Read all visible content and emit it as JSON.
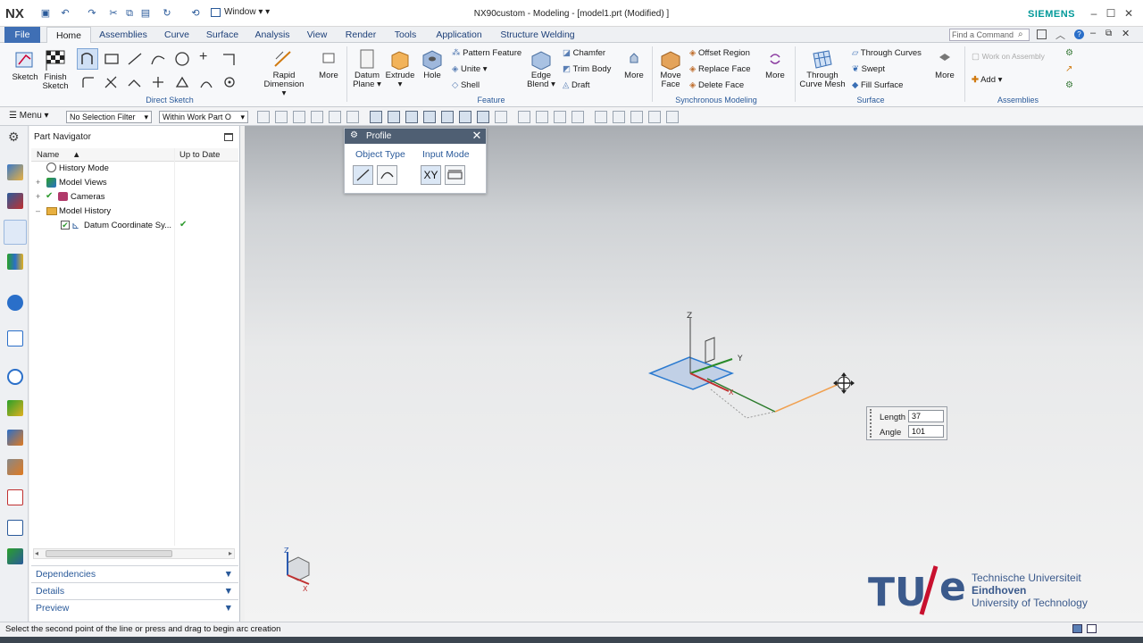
{
  "app": {
    "logo": "NX",
    "title": "NX90custom - Modeling - [model1.prt (Modified) ]",
    "brand": "SIEMENS",
    "window_menu": "Window"
  },
  "tabs": [
    "File",
    "Home",
    "Assemblies",
    "Curve",
    "Surface",
    "Analysis",
    "View",
    "Render",
    "Tools",
    "Application",
    "Structure Welding"
  ],
  "command_search": {
    "placeholder": "Find a Command"
  },
  "ribbon": {
    "direct_sketch": {
      "sketch": "Sketch",
      "finish_sketch": [
        "Finish",
        "Sketch"
      ],
      "rapid_dimension": [
        "Rapid",
        "Dimension"
      ],
      "more": "More",
      "group": "Direct Sketch"
    },
    "feature": {
      "datum_plane": [
        "Datum",
        "Plane"
      ],
      "extrude": "Extrude",
      "hole": "Hole",
      "pattern_feature": "Pattern Feature",
      "unite": "Unite",
      "shell": "Shell",
      "edge_blend": [
        "Edge",
        "Blend"
      ],
      "chamfer": "Chamfer",
      "trim_body": "Trim Body",
      "draft": "Draft",
      "more": "More",
      "group": "Feature"
    },
    "sync": {
      "move_face": [
        "Move",
        "Face"
      ],
      "offset_region": "Offset Region",
      "replace_face": "Replace Face",
      "delete_face": "Delete Face",
      "more": "More",
      "group": "Synchronous Modeling"
    },
    "surface": {
      "through_curve_mesh": [
        "Through",
        "Curve Mesh"
      ],
      "through_curves": "Through Curves",
      "swept": "Swept",
      "fill_surface": "Fill Surface",
      "more": "More",
      "group": "Surface"
    },
    "assemblies": {
      "work_on_assembly": "Work on Assembly",
      "add": "Add",
      "group": "Assemblies"
    }
  },
  "toolbar2": {
    "menu": "Menu",
    "selection_filter": "No Selection Filter",
    "scope": "Within Work Part O"
  },
  "navigator": {
    "title": "Part Navigator",
    "columns": [
      "Name",
      "Up to Date"
    ],
    "rows": [
      {
        "label": "History Mode",
        "status": ""
      },
      {
        "label": "Model Views",
        "status": ""
      },
      {
        "label": "Cameras",
        "status": ""
      },
      {
        "label": "Model History",
        "status": ""
      },
      {
        "label": "Datum Coordinate Sy...",
        "status": "✔"
      }
    ],
    "sections": [
      "Dependencies",
      "Details",
      "Preview"
    ]
  },
  "profile_dialog": {
    "title": "Profile",
    "object_type": "Object Type",
    "input_mode": "Input Mode",
    "xy": "XY"
  },
  "length_box": {
    "length_label": "Length",
    "length_value": "37",
    "angle_label": "Angle",
    "angle_value": "101"
  },
  "axes": {
    "z": "Z",
    "y": "Y",
    "x": "X"
  },
  "tue": {
    "line1": "Technische Universiteit",
    "line2": "Eindhoven",
    "line3": "University of Technology"
  },
  "status": "Select the second point of the line or press and drag to begin arc creation",
  "colors": {
    "accent": "#3f6fb5",
    "siemens": "#009999",
    "tue": "#3b5a8c",
    "tue_slash": "#c8102e",
    "check": "#2e9b2e"
  }
}
